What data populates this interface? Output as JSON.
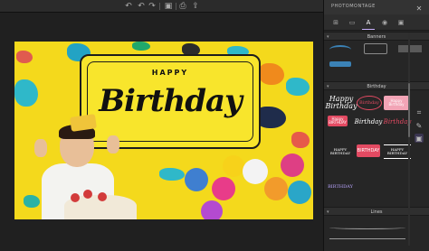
{
  "app": {
    "panel_title": "PHOTOMONTAGE"
  },
  "toolbar": {
    "icons": [
      "undo-icon",
      "undo-back-icon",
      "redo-icon",
      "save-icon",
      "print-icon",
      "share-icon"
    ]
  },
  "artwork": {
    "banner_small": "HAPPY",
    "banner_big": "Birthday"
  },
  "panel": {
    "tabs": [
      "stickers-tab",
      "frames-tab",
      "text-tab",
      "bulb-tab",
      "camera-tab"
    ],
    "sections": [
      {
        "label": "Banners"
      },
      {
        "label": "Birthday"
      },
      {
        "label": "Lines"
      }
    ],
    "birthday_thumbs": [
      "Happy Birthday",
      "Birthday",
      "Happy Birthday",
      "Happy BIRTHDAY",
      "Birthday",
      "Birthday",
      "BIRTHDAY",
      "HAPPY BIRTHDAY",
      "HAPPY BIRTHDAY",
      "BIRTHDAY"
    ]
  },
  "colors": {
    "accent": "#cbb4ff",
    "artwork_bg": "#f4d91c",
    "pink": "#e34a62"
  }
}
